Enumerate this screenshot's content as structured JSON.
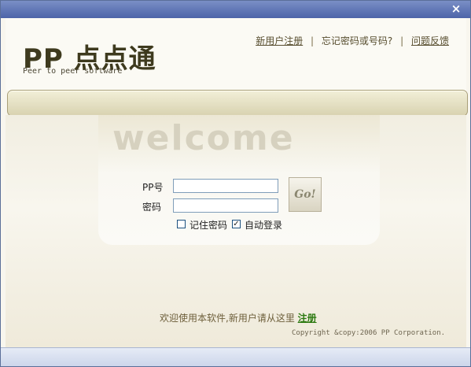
{
  "titlebar": {
    "close_glyph": "×"
  },
  "header": {
    "logo_text": "PP 点点通",
    "tagline": "Peer to peer software",
    "links": {
      "register": "新用户注册",
      "forgot": "忘记密码或号码?",
      "feedback": "问题反馈",
      "separator": "|"
    }
  },
  "login": {
    "welcome": "welcome",
    "pp_label": "PP号",
    "password_label": "密码",
    "pp_value": "",
    "password_value": "",
    "go_label": "Go!",
    "remember_label": "记住密码",
    "remember_checked": false,
    "autologin_label": "自动登录",
    "autologin_checked": true
  },
  "footer": {
    "message": "欢迎使用本软件,新用户请从这里",
    "register_link": "注册",
    "copyright": "Copyright &copy:2006 PP Corporation."
  },
  "colors": {
    "titlebar": "#4d64a8",
    "accent_link": "#2d7a11",
    "text_brown": "#574d2e"
  }
}
